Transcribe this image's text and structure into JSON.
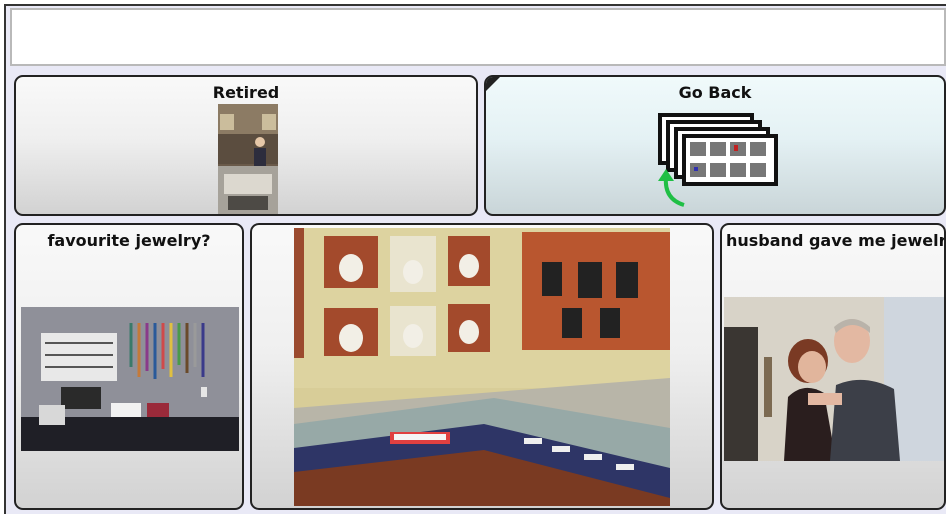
{
  "message_bar": {
    "text": ""
  },
  "cells": {
    "retired": {
      "label": "Retired"
    },
    "go_back": {
      "label": "Go Back"
    },
    "favourite_jewelry": {
      "label": "favourite jewelry?"
    },
    "husband_jewelry": {
      "label": "husband gave me jewelry"
    },
    "photo_store": {
      "label": ""
    }
  },
  "colors": {
    "cell_border": "#222222",
    "go_back_tint": "#e4f1f4",
    "arrow_green": "#1fbf45"
  },
  "icons": {
    "go_back": "stacked-pages-back-icon"
  }
}
